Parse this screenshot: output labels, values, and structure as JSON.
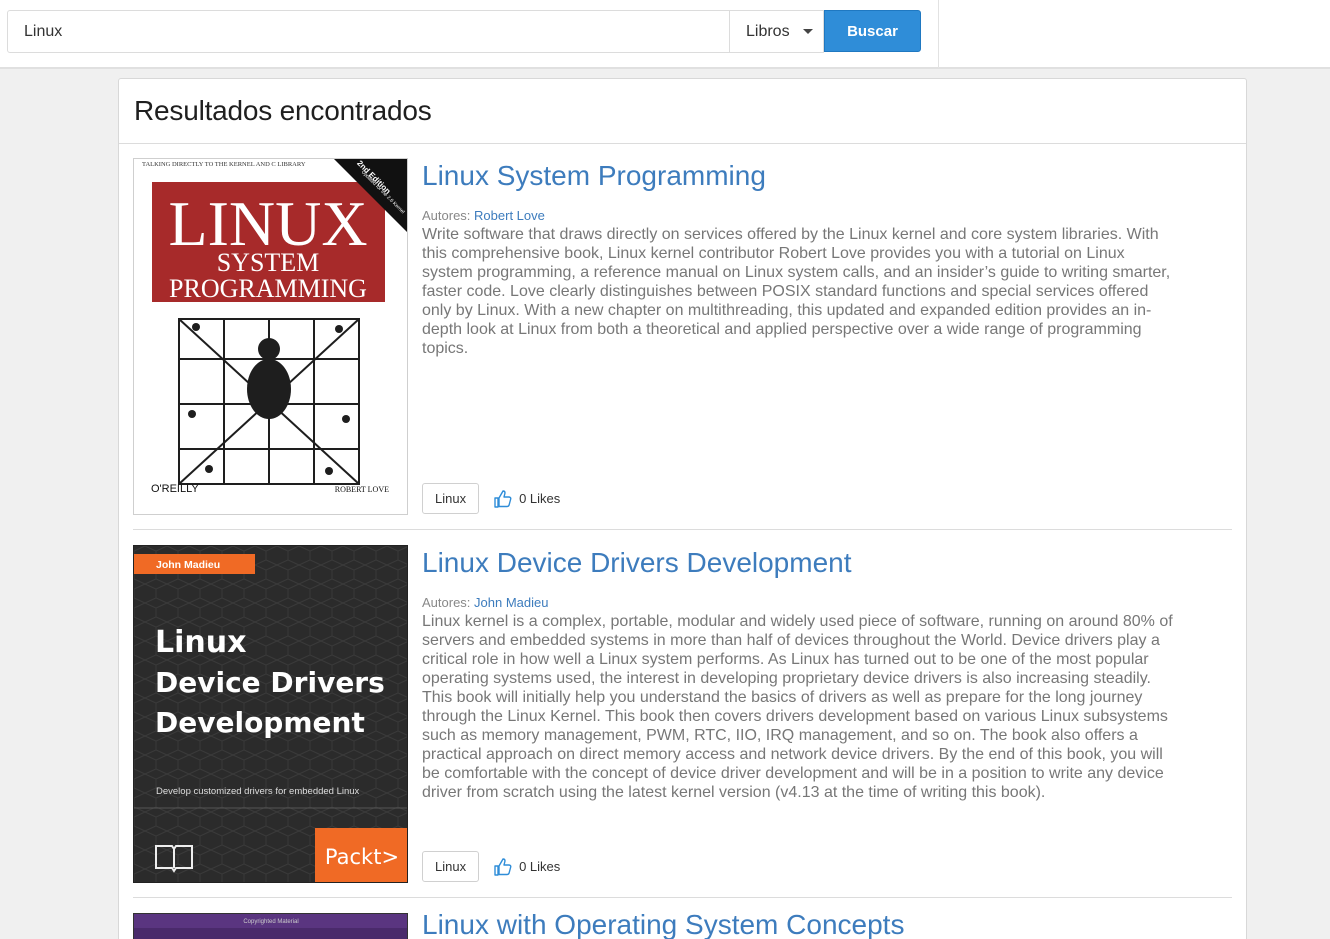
{
  "search": {
    "value": "Linux",
    "placeholder": ""
  },
  "category": {
    "selected": "Libros"
  },
  "search_button": "Buscar",
  "results_title": "Resultados encontrados",
  "authors_label": "Autores:",
  "results": [
    {
      "title": "Linux System Programming",
      "author": "Robert Love",
      "description": "Write software that draws directly on services offered by the Linux kernel and core system libraries. With this comprehensive book, Linux kernel contributor Robert Love provides you with a tutorial on Linux system programming, a reference manual on Linux system calls, and an insider’s guide to writing smarter, faster code. Love clearly distinguishes between POSIX standard functions and special services offered only by Linux. With a new chapter on multithreading, this updated and expanded edition provides an in-depth look at Linux from both a theoretical and applied perspective over a wide range of programming topics.",
      "tag": "Linux",
      "likes": "0 Likes",
      "cover": {
        "top_text": "TALKING DIRECTLY TO THE KERNEL AND C LIBRARY",
        "edition": "2nd Edition",
        "edition_sub": "Updated for the 2.6 Kernel",
        "line1": "LINUX",
        "line2": "SYSTEM",
        "line3": "PROGRAMMING",
        "publisher": "O'REILLY",
        "author": "ROBERT LOVE"
      }
    },
    {
      "title": "Linux Device Drivers Development",
      "author": "John Madieu",
      "description": "Linux kernel is a complex, portable, modular and widely used piece of software, running on around 80% of servers and embedded systems in more than half of devices throughout the World. Device drivers play a critical role in how well a Linux system performs. As Linux has turned out to be one of the most popular operating systems used, the interest in developing proprietary device drivers is also increasing steadily. This book will initially help you understand the basics of drivers as well as prepare for the long journey through the Linux Kernel. This book then covers drivers development based on various Linux subsystems such as memory management, PWM, RTC, IIO, IRQ management, and so on. The book also offers a practical approach on direct memory access and network device drivers. By the end of this book, you will be comfortable with the concept of device driver development and will be in a position to write any device driver from scratch using the latest kernel version (v4.13 at the time of writing this book).",
      "tag": "Linux",
      "likes": "0 Likes",
      "cover": {
        "author": "John Madieu",
        "line1": "Linux",
        "line2": "Device Drivers",
        "line3": "Development",
        "subtitle": "Develop customized drivers for embedded Linux",
        "publisher": "Packt>"
      }
    },
    {
      "title": "Linux with Operating System Concepts",
      "cover": {
        "top_text": "Copyrighted Material"
      }
    }
  ],
  "colors": {
    "link": "#3d7cbd",
    "button": "#2f8dd8",
    "cover1_red": "#a72a2a",
    "cover2_dark": "#2b2b2b",
    "cover2_orange": "#f06a25",
    "cover3_purple": "#4a2a6b"
  }
}
